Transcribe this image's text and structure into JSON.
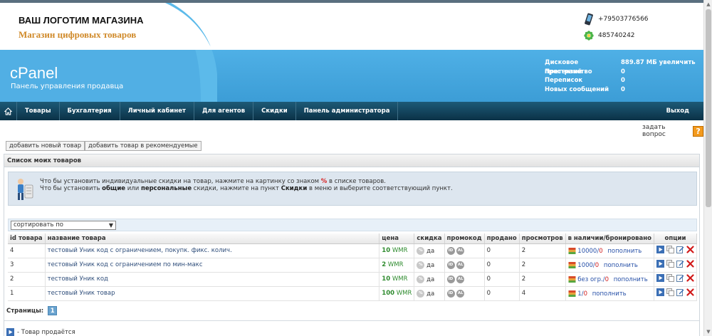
{
  "header": {
    "logo_title": "ВАШ ЛОГОТИМ МАГАЗИНА",
    "logo_subtitle": "Магазин цифровых товаров",
    "app_title": "cPanel",
    "app_subtitle": "Панель управления продавца",
    "phone": "+79503776566",
    "icq": "485740242",
    "stats": [
      {
        "label": "Дисковое пространство",
        "value": "889.87 МБ увеличить"
      },
      {
        "label": "Претензий",
        "value": "0"
      },
      {
        "label": "Переписок",
        "value": "0"
      },
      {
        "label": "Новых сообщений",
        "value": "0"
      }
    ]
  },
  "nav": {
    "items": [
      "Товары",
      "Бухгалтерия",
      "Личный кабинет",
      "Для агентов",
      "Скидки",
      "Панель администратора"
    ],
    "exit": "Выход"
  },
  "ask_question": "задать вопрос",
  "ask_icon": "?",
  "buttons": {
    "add_product": "добавить новый товар",
    "add_recommended": "добавить товар в рекомендуемые"
  },
  "list": {
    "title": "Список моих товаров",
    "info": {
      "l1_a": "Что бы установить индивидуальные скидки на товар, нажмите на картинку со знаком ",
      "l1_pct": "%",
      "l1_b": " в списке товаров.",
      "l2_a": "Что бы установить ",
      "l2_b1": "общие",
      "l2_c": " или ",
      "l2_b2": "персональные",
      "l2_d": " скидки, нажмите на пункт ",
      "l2_b3": "Скидки",
      "l2_e": " в меню и выберите соответствующий пункт."
    },
    "sort": {
      "value": "сортировать по",
      "arrow": "▼"
    },
    "columns": [
      "id товара",
      "название товара",
      "цена",
      "скидка",
      "промокод",
      "продано",
      "просмотров",
      "в наличии/бронировано",
      "опции"
    ],
    "discount_label": "да",
    "fill_label": "пополнить",
    "promo_icons": [
      "ID",
      "AL"
    ],
    "rows": [
      {
        "id": "4",
        "name": "тестовый Уник код с ограничением, покупк. фикс. колич.",
        "price": "10",
        "currency": "WMR",
        "sold": "0",
        "views": "2",
        "stock": "10000",
        "stock_sep": "/",
        "reserved": "0"
      },
      {
        "id": "3",
        "name": "тестовый Уник код с ограничением по мин-макс",
        "price": "2",
        "currency": "WMR",
        "sold": "0",
        "views": "2",
        "stock": "1000",
        "stock_sep": "/",
        "reserved": "0"
      },
      {
        "id": "2",
        "name": "тестовый Уник код",
        "price": "10",
        "currency": "WMR",
        "sold": "0",
        "views": "2",
        "stock": "без огр.",
        "stock_sep": "/",
        "reserved": "0"
      },
      {
        "id": "1",
        "name": "тестовый Уник товар",
        "price": "100",
        "currency": "WMR",
        "sold": "0",
        "views": "4",
        "stock": "1",
        "stock_sep": "/",
        "reserved": "0"
      }
    ],
    "pages_label": "Страницы:",
    "current_page": "1",
    "legend_selling": "- Товар продаётся"
  }
}
